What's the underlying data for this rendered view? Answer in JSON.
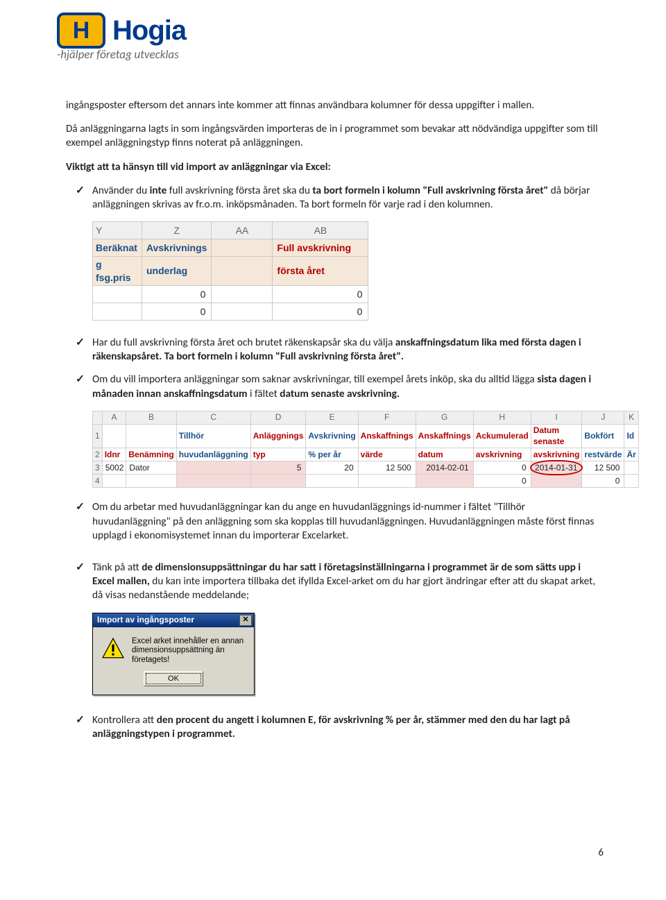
{
  "logo": {
    "h": "H",
    "name": "Hogia",
    "tagline": "-hjälper företag utvecklas"
  },
  "para1": "ingångsposter eftersom det annars inte kommer att finnas användbara kolumner för dessa uppgifter i mallen.",
  "para2": "Då anläggningarna lagts in som ingångsvärden importeras de in i programmet som bevakar att nödvändiga uppgifter som till exempel anläggningstyp finns noterat på anläggningen.",
  "para3": "Viktigt att ta hänsyn till vid import av anläggningar via Excel:",
  "b1a": "Använder du ",
  "b1b": "inte",
  "b1c": " full avskrivning första året ska du ",
  "b1d": "ta bort formeln i kolumn \"Full avskrivning första året\"",
  "b1e": " då börjar anläggningen skrivas av fr.o.m. inköpsmånaden. Ta bort formeln för varje rad i den kolumnen.",
  "excel1": {
    "cols": [
      "Y",
      "Z",
      "AA",
      "AB"
    ],
    "h1a": "Beräknat",
    "h1b": "Avskrivnings",
    "h2a": "g  fsg.pris",
    "h2b": "underlag",
    "hred": "Full avskrivning",
    "hred2": "första året",
    "zeros": "0"
  },
  "b2a": "Har du full avskrivning första året och brutet räkenskapsår ska du välja ",
  "b2b": "anskaffningsdatum lika med första dagen i räkenskapsåret. Ta bort formeln i kolumn \"Full avskrivning första året\".",
  "b3a": "Om du vill importera anläggningar som saknar avskrivningar, till exempel årets inköp, ska du alltid lägga ",
  "b3b": "sista dagen i månaden innan anskaffningsdatum",
  "b3c": " i fältet ",
  "b3d": "datum senaste avskrivning.",
  "excel2": {
    "cols": [
      "A",
      "B",
      "C",
      "D",
      "E",
      "F",
      "G",
      "H",
      "I",
      "J",
      "K"
    ],
    "h_top": [
      "",
      "",
      "Tillhör",
      "Anläggnings",
      "Avskrivning",
      "Anskaffnings",
      "Anskaffnings",
      "Ackumulerad",
      "Datum senaste",
      "Bokfört",
      "Id"
    ],
    "h_bot": [
      "Idnr",
      "Benämning",
      "huvudanläggning",
      "typ",
      "% per år",
      "värde",
      "datum",
      "avskrivning",
      "avskrivning",
      "restvärde",
      "Är"
    ],
    "row": [
      "5002",
      "Dator",
      "",
      "5",
      "20",
      "12 500",
      "2014-02-01",
      "0",
      "2014-01-31",
      "12 500",
      ""
    ],
    "row2_h": "0",
    "row2_j": "0"
  },
  "b4": "Om du arbetar med huvudanläggningar kan du ange en huvudanläggnings id-nummer i fältet \"Tillhör huvudanläggning\" på den anläggning som ska kopplas till huvudanläggningen. Huvudanläggningen måste först finnas upplagd i ekonomisystemet innan du importerar Excelarket.",
  "b5a": "Tänk på att ",
  "b5b": "de dimensionsuppsättningar du har satt i företagsinställningarna i programmet är de som sätts upp i Excel mallen,",
  "b5c": " du kan inte importera tillbaka det ifyllda Excel-arket om du har gjort ändringar efter att du skapat arket, då visas nedanstående meddelande;",
  "dialog": {
    "title": "Import av ingångsposter",
    "body": "Excel arket innehåller en annan dimensionsuppsättning än företagets!",
    "ok": "OK"
  },
  "b6a": "Kontrollera att ",
  "b6b": "den procent du angett i kolumnen E, för avskrivning % per år, stämmer med den du har lagt på anläggningstypen i programmet.",
  "page_number": "6"
}
